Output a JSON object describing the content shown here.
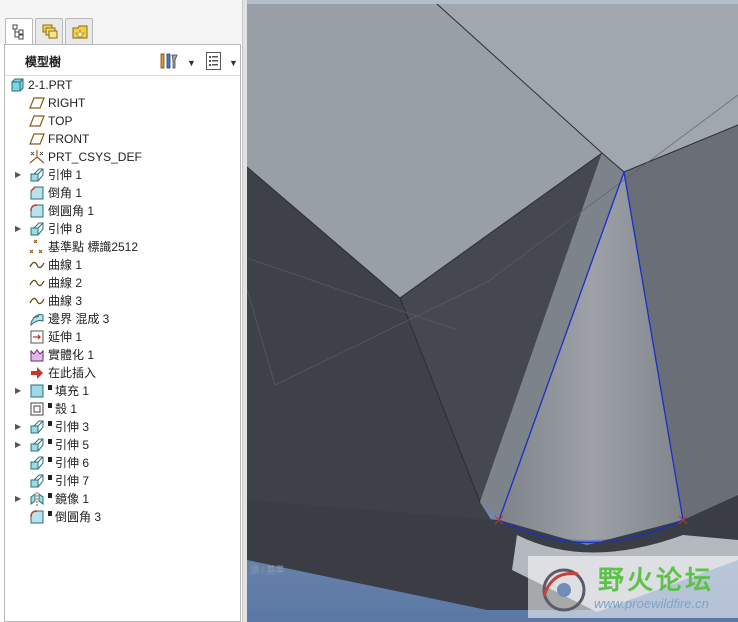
{
  "model_tree": {
    "title": "模型樹",
    "tabs": [
      {
        "icon": "model-tree-icon",
        "active": true
      },
      {
        "icon": "layers-icon",
        "active": false
      },
      {
        "icon": "favorites-folder-icon",
        "active": false
      }
    ],
    "header_buttons": [
      {
        "icon": "tree-settings-icon"
      },
      {
        "icon": "tree-columns-icon"
      }
    ],
    "items": [
      {
        "label": "2-1.PRT",
        "icon": "part-icon",
        "expander": "",
        "suppressed": false
      },
      {
        "label": "RIGHT",
        "icon": "datum-plane-icon",
        "expander": "",
        "suppressed": false
      },
      {
        "label": "TOP",
        "icon": "datum-plane-icon",
        "expander": "",
        "suppressed": false
      },
      {
        "label": "FRONT",
        "icon": "datum-plane-icon",
        "expander": "",
        "suppressed": false
      },
      {
        "label": "PRT_CSYS_DEF",
        "icon": "csys-icon",
        "expander": "",
        "suppressed": false
      },
      {
        "label": "引伸 1",
        "icon": "extrude-icon",
        "expander": "▶",
        "suppressed": false
      },
      {
        "label": "倒角 1",
        "icon": "chamfer-icon",
        "expander": "",
        "suppressed": false
      },
      {
        "label": "倒圓角 1",
        "icon": "round-icon",
        "expander": "",
        "suppressed": false
      },
      {
        "label": "引伸 8",
        "icon": "extrude-icon",
        "expander": "▶",
        "suppressed": false
      },
      {
        "label": "基準點 標識2512",
        "icon": "datum-point-icon",
        "expander": "",
        "suppressed": false
      },
      {
        "label": "曲線 1",
        "icon": "curve-icon",
        "expander": "",
        "suppressed": false
      },
      {
        "label": "曲線 2",
        "icon": "curve-icon",
        "expander": "",
        "suppressed": false
      },
      {
        "label": "曲線 3",
        "icon": "curve-icon",
        "expander": "",
        "suppressed": false
      },
      {
        "label": "邊界 混成 3",
        "icon": "boundary-blend-icon",
        "expander": "",
        "suppressed": false
      },
      {
        "label": "延伸 1",
        "icon": "extend-icon",
        "expander": "",
        "suppressed": false
      },
      {
        "label": "實體化 1",
        "icon": "solidify-icon",
        "expander": "",
        "suppressed": false
      },
      {
        "label": "在此插入",
        "icon": "insert-here-arrow-icon",
        "expander": "",
        "suppressed": false
      },
      {
        "label": "填充 1",
        "icon": "fill-icon",
        "expander": "▶",
        "suppressed": true
      },
      {
        "label": "殼 1",
        "icon": "shell-icon",
        "expander": "",
        "suppressed": true
      },
      {
        "label": "引伸 3",
        "icon": "extrude-icon",
        "expander": "▶",
        "suppressed": true
      },
      {
        "label": "引伸 5",
        "icon": "extrude-icon",
        "expander": "▶",
        "suppressed": true
      },
      {
        "label": "引伸 6",
        "icon": "extrude-icon",
        "expander": "",
        "suppressed": true
      },
      {
        "label": "引伸 7",
        "icon": "extrude-icon",
        "expander": "",
        "suppressed": true
      },
      {
        "label": "鏡像 1",
        "icon": "mirror-icon",
        "expander": "▶",
        "suppressed": true
      },
      {
        "label": "倒圓角 3",
        "icon": "round-icon",
        "expander": "",
        "suppressed": true
      }
    ]
  },
  "viewport": {
    "background_top": "#a9b6c4",
    "background_bottom": "#5d7aa6",
    "faint_label": "頂 / 基準",
    "curve_color": "#1a2ec8"
  },
  "watermark": {
    "text_cn": "野火论坛",
    "url": "www.proewildfire.cn"
  },
  "colors": {
    "top_face": "#98a0a8",
    "dark_face": "#3f4349",
    "mid_face": "#6b7079",
    "blend_face": "#8a8f96"
  }
}
